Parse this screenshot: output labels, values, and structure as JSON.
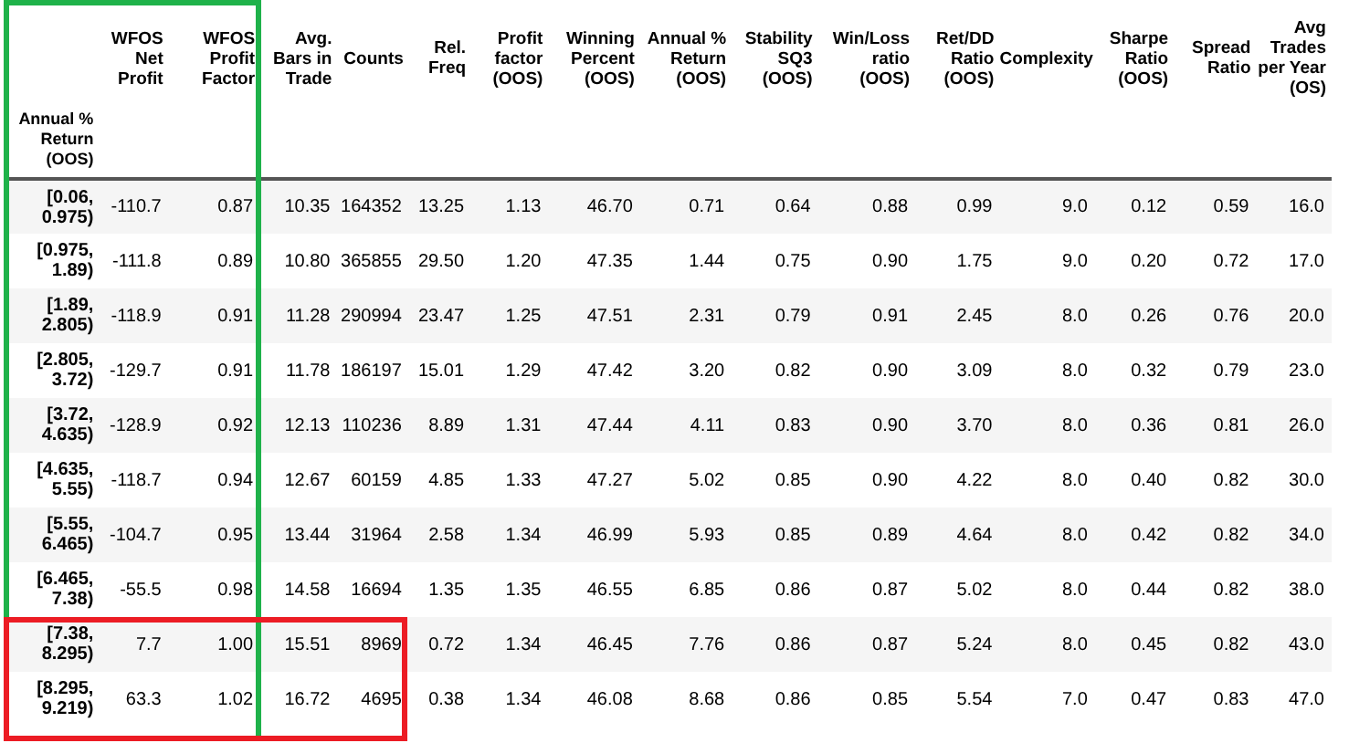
{
  "table": {
    "index_name": "Annual % Return (OOS)",
    "columns": [
      "WFOS Net Profit",
      "WFOS Profit Factor",
      "Avg. Bars in Trade",
      "Counts",
      "Rel. Freq",
      "Profit factor (OOS)",
      "Winning Percent (OOS)",
      "Annual % Return (OOS)",
      "Stability SQ3 (OOS)",
      "Win/Loss ratio (OOS)",
      "Ret/DD Ratio (OOS)",
      "Complexity",
      "Sharpe Ratio (OOS)",
      "Spread Ratio",
      "Avg Trades per Year (OS)"
    ],
    "rows": [
      {
        "index": "[0.06, 0.975)",
        "cells": [
          "-110.7",
          "0.87",
          "10.35",
          "164352",
          "13.25",
          "1.13",
          "46.70",
          "0.71",
          "0.64",
          "0.88",
          "0.99",
          "9.0",
          "0.12",
          "0.59",
          "16.0"
        ]
      },
      {
        "index": "[0.975, 1.89)",
        "cells": [
          "-111.8",
          "0.89",
          "10.80",
          "365855",
          "29.50",
          "1.20",
          "47.35",
          "1.44",
          "0.75",
          "0.90",
          "1.75",
          "9.0",
          "0.20",
          "0.72",
          "17.0"
        ]
      },
      {
        "index": "[1.89, 2.805)",
        "cells": [
          "-118.9",
          "0.91",
          "11.28",
          "290994",
          "23.47",
          "1.25",
          "47.51",
          "2.31",
          "0.79",
          "0.91",
          "2.45",
          "8.0",
          "0.26",
          "0.76",
          "20.0"
        ]
      },
      {
        "index": "[2.805, 3.72)",
        "cells": [
          "-129.7",
          "0.91",
          "11.78",
          "186197",
          "15.01",
          "1.29",
          "47.42",
          "3.20",
          "0.82",
          "0.90",
          "3.09",
          "8.0",
          "0.32",
          "0.79",
          "23.0"
        ]
      },
      {
        "index": "[3.72, 4.635)",
        "cells": [
          "-128.9",
          "0.92",
          "12.13",
          "110236",
          "8.89",
          "1.31",
          "47.44",
          "4.11",
          "0.83",
          "0.90",
          "3.70",
          "8.0",
          "0.36",
          "0.81",
          "26.0"
        ]
      },
      {
        "index": "[4.635, 5.55)",
        "cells": [
          "-118.7",
          "0.94",
          "12.67",
          "60159",
          "4.85",
          "1.33",
          "47.27",
          "5.02",
          "0.85",
          "0.90",
          "4.22",
          "8.0",
          "0.40",
          "0.82",
          "30.0"
        ]
      },
      {
        "index": "[5.55, 6.465)",
        "cells": [
          "-104.7",
          "0.95",
          "13.44",
          "31964",
          "2.58",
          "1.34",
          "46.99",
          "5.93",
          "0.85",
          "0.89",
          "4.64",
          "8.0",
          "0.42",
          "0.82",
          "34.0"
        ]
      },
      {
        "index": "[6.465, 7.38)",
        "cells": [
          "-55.5",
          "0.98",
          "14.58",
          "16694",
          "1.35",
          "1.35",
          "46.55",
          "6.85",
          "0.86",
          "0.87",
          "5.02",
          "8.0",
          "0.44",
          "0.82",
          "38.0"
        ]
      },
      {
        "index": "[7.38, 8.295)",
        "cells": [
          "7.7",
          "1.00",
          "15.51",
          "8969",
          "0.72",
          "1.34",
          "46.45",
          "7.76",
          "0.86",
          "0.87",
          "5.24",
          "8.0",
          "0.45",
          "0.82",
          "43.0"
        ]
      },
      {
        "index": "[8.295, 9.219)",
        "cells": [
          "63.3",
          "1.02",
          "16.72",
          "4695",
          "0.38",
          "1.34",
          "46.08",
          "8.68",
          "0.86",
          "0.85",
          "5.54",
          "7.0",
          "0.47",
          "0.83",
          "47.0"
        ]
      }
    ]
  },
  "highlights": [
    {
      "kind": "column_group",
      "color": "#1fb24a"
    },
    {
      "kind": "row_group",
      "color": "#ec1c24"
    }
  ]
}
